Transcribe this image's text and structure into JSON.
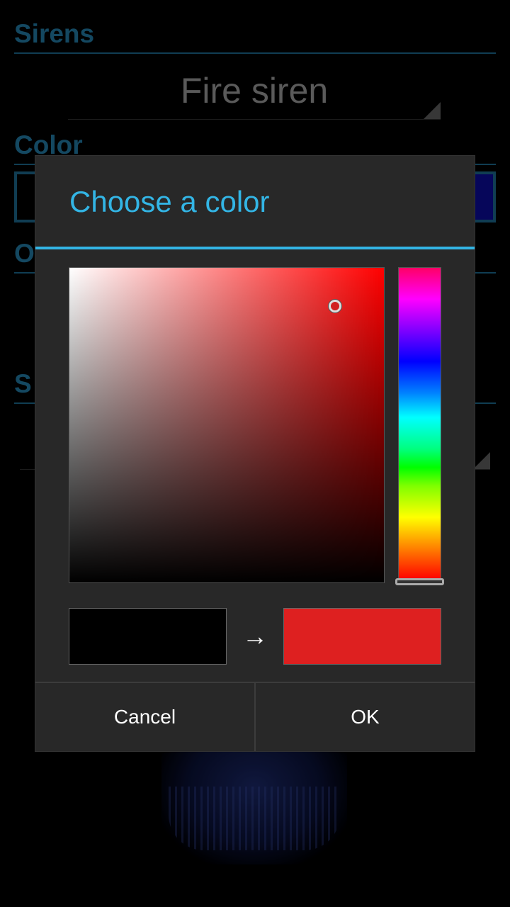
{
  "settings": {
    "sections": {
      "sirens": "Sirens",
      "color": "Color",
      "other": "O",
      "sound": "S"
    },
    "siren_spinner": {
      "value": "Fire siren"
    }
  },
  "dialog": {
    "title": "Choose a color",
    "arrow": "→",
    "old_color": "#000000",
    "new_color": "#de2020",
    "hue": "red",
    "buttons": {
      "cancel": "Cancel",
      "ok": "OK"
    }
  },
  "colors": {
    "accent": "#33b5e5",
    "dialog_background": "#282828",
    "section_header": "#1f6f95"
  }
}
